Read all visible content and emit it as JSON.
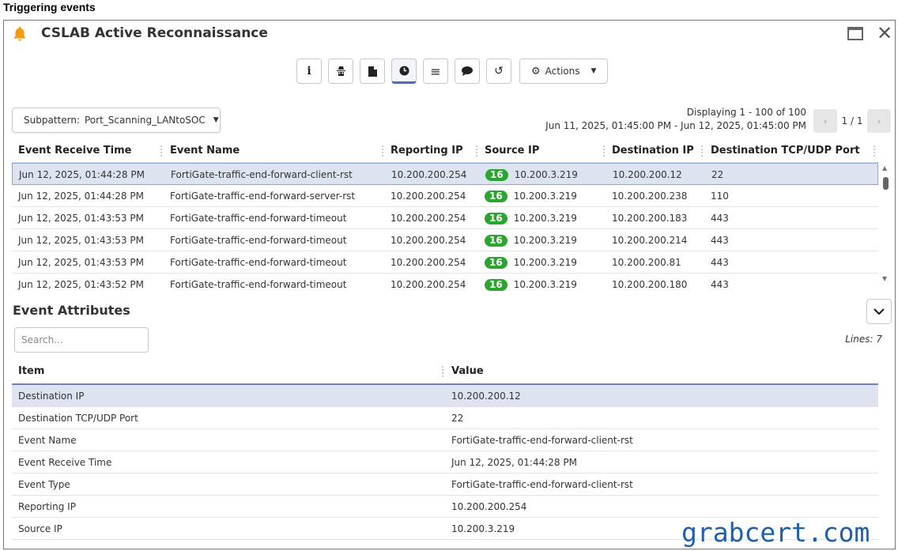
{
  "caption": "Triggering events",
  "window": {
    "title": "CSLAB Active Reconnaissance",
    "bell_icon": "bell-icon",
    "accent": "#f39c12"
  },
  "toolbar": {
    "buttons": [
      {
        "icon": "info-icon",
        "glyph": "i"
      },
      {
        "icon": "spy-icon",
        "glyph": "🕵"
      },
      {
        "icon": "file-icon",
        "glyph": "▮"
      },
      {
        "icon": "clock-icon",
        "glyph": "◷"
      },
      {
        "icon": "list-icon",
        "glyph": "≡"
      },
      {
        "icon": "comment-icon",
        "glyph": "●"
      },
      {
        "icon": "history-icon",
        "glyph": "↺"
      }
    ],
    "actions_label": "Actions"
  },
  "subpattern": {
    "label": "Subpattern:",
    "value": "Port_Scanning_LANtoSOC"
  },
  "display": {
    "range": "Displaying 1 - 100 of 100",
    "timespan": "Jun 11, 2025, 01:45:00 PM - Jun 12, 2025, 01:45:00 PM",
    "page": "1 / 1"
  },
  "events": {
    "columns": [
      "Event Receive Time",
      "Event Name",
      "Reporting IP",
      "Source IP",
      "Destination IP",
      "Destination TCP/UDP Port"
    ],
    "rows": [
      {
        "time": "Jun 12, 2025, 01:44:28 PM",
        "name": "FortiGate-traffic-end-forward-client-rst",
        "reporting_ip": "10.200.200.254",
        "badge": "16",
        "source_ip": "10.200.3.219",
        "dest_ip": "10.200.200.12",
        "port": "22"
      },
      {
        "time": "Jun 12, 2025, 01:44:28 PM",
        "name": "FortiGate-traffic-end-forward-server-rst",
        "reporting_ip": "10.200.200.254",
        "badge": "16",
        "source_ip": "10.200.3.219",
        "dest_ip": "10.200.200.238",
        "port": "110"
      },
      {
        "time": "Jun 12, 2025, 01:43:53 PM",
        "name": "FortiGate-traffic-end-forward-timeout",
        "reporting_ip": "10.200.200.254",
        "badge": "16",
        "source_ip": "10.200.3.219",
        "dest_ip": "10.200.200.183",
        "port": "443"
      },
      {
        "time": "Jun 12, 2025, 01:43:53 PM",
        "name": "FortiGate-traffic-end-forward-timeout",
        "reporting_ip": "10.200.200.254",
        "badge": "16",
        "source_ip": "10.200.3.219",
        "dest_ip": "10.200.200.214",
        "port": "443"
      },
      {
        "time": "Jun 12, 2025, 01:43:53 PM",
        "name": "FortiGate-traffic-end-forward-timeout",
        "reporting_ip": "10.200.200.254",
        "badge": "16",
        "source_ip": "10.200.3.219",
        "dest_ip": "10.200.200.81",
        "port": "443"
      },
      {
        "time": "Jun 12, 2025, 01:43:52 PM",
        "name": "FortiGate-traffic-end-forward-timeout",
        "reporting_ip": "10.200.200.254",
        "badge": "16",
        "source_ip": "10.200.3.219",
        "dest_ip": "10.200.200.180",
        "port": "443"
      }
    ]
  },
  "attributes": {
    "title": "Event Attributes",
    "search_placeholder": "Search...",
    "lines": "Lines: 7",
    "columns": [
      "Item",
      "Value"
    ],
    "rows": [
      {
        "item": "Destination IP",
        "value": "10.200.200.12"
      },
      {
        "item": "Destination TCP/UDP Port",
        "value": "22"
      },
      {
        "item": "Event Name",
        "value": "FortiGate-traffic-end-forward-client-rst"
      },
      {
        "item": "Event Receive Time",
        "value": "Jun 12, 2025, 01:44:28 PM"
      },
      {
        "item": "Event Type",
        "value": "FortiGate-traffic-end-forward-client-rst"
      },
      {
        "item": "Reporting IP",
        "value": "10.200.200.254"
      },
      {
        "item": "Source IP",
        "value": "10.200.3.219"
      }
    ]
  },
  "watermark": "grabcert.com"
}
